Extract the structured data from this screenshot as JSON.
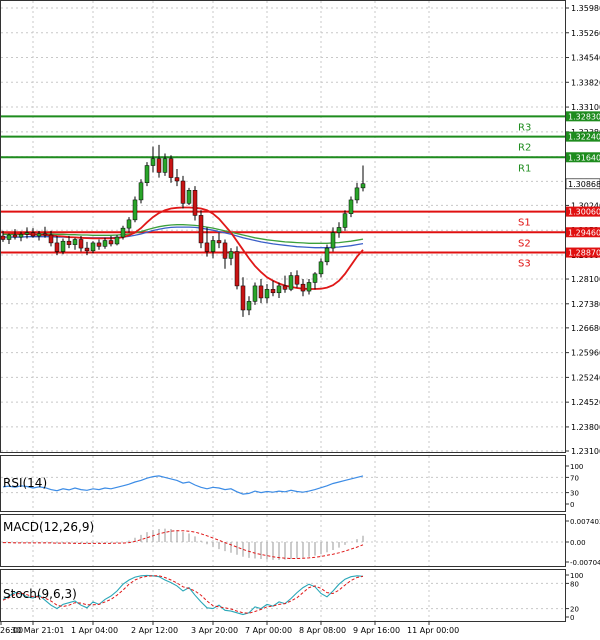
{
  "chart_data": {
    "type": "candlestick",
    "main": {
      "price_ticks": [
        "1.35980",
        "1.35260",
        "1.34540",
        "1.33820",
        "1.33100",
        "1.32380",
        "1.31660",
        "1.30940",
        "1.30240",
        "1.29520",
        "1.28800",
        "1.28100",
        "1.27380",
        "1.26680",
        "1.25960",
        "1.25240",
        "1.24520",
        "1.23800",
        "1.23100"
      ],
      "price_tick_values": [
        1.3598,
        1.3526,
        1.3454,
        1.3382,
        1.331,
        1.3238,
        1.3166,
        1.3094,
        1.3024,
        1.2952,
        1.288,
        1.281,
        1.2738,
        1.2668,
        1.2596,
        1.2524,
        1.2452,
        1.238,
        1.231
      ],
      "ylim": [
        1.231,
        1.3598
      ],
      "current_price": {
        "value": 1.30868,
        "label": "1.30868"
      },
      "levels": [
        {
          "name": "R3",
          "value": 1.3283,
          "label": "1.32830",
          "color": "#1e8c1e"
        },
        {
          "name": "R2",
          "value": 1.3224,
          "label": "1.32240",
          "color": "#1e8c1e"
        },
        {
          "name": "R1",
          "value": 1.3164,
          "label": "1.31640",
          "color": "#1e8c1e"
        },
        {
          "name": "S1",
          "value": 1.3006,
          "label": "1.30060",
          "color": "#e01010"
        },
        {
          "name": "S2",
          "value": 1.2946,
          "label": "1.29460",
          "color": "#e01010"
        },
        {
          "name": "S3",
          "value": 1.2887,
          "label": "1.28870",
          "color": "#e01010"
        }
      ],
      "candles": [
        [
          1.2935,
          1.295,
          1.2918,
          1.2925
        ],
        [
          1.2925,
          1.2942,
          1.2912,
          1.2938
        ],
        [
          1.2938,
          1.2955,
          1.2925,
          1.2932
        ],
        [
          1.2932,
          1.2948,
          1.292,
          1.294
        ],
        [
          1.294,
          1.296,
          1.2928,
          1.2945
        ],
        [
          1.2945,
          1.2958,
          1.293,
          1.2935
        ],
        [
          1.2935,
          1.295,
          1.2922,
          1.2942
        ],
        [
          1.2942,
          1.2962,
          1.293,
          1.2938
        ],
        [
          1.2938,
          1.295,
          1.2905,
          1.2915
        ],
        [
          1.2915,
          1.2935,
          1.288,
          1.289
        ],
        [
          1.289,
          1.2928,
          1.2882,
          1.292
        ],
        [
          1.292,
          1.2935,
          1.29,
          1.291
        ],
        [
          1.291,
          1.293,
          1.2895,
          1.2925
        ],
        [
          1.2925,
          1.2935,
          1.289,
          1.29
        ],
        [
          1.29,
          1.2918,
          1.288,
          1.2892
        ],
        [
          1.2892,
          1.292,
          1.2885,
          1.2915
        ],
        [
          1.2915,
          1.2925,
          1.2895,
          1.2905
        ],
        [
          1.2905,
          1.293,
          1.2898,
          1.2922
        ],
        [
          1.2922,
          1.2935,
          1.2905,
          1.2912
        ],
        [
          1.2912,
          1.2938,
          1.2908,
          1.2932
        ],
        [
          1.2932,
          1.2965,
          1.2925,
          1.2958
        ],
        [
          1.2958,
          1.299,
          1.2945,
          1.2982
        ],
        [
          1.2982,
          1.305,
          1.2975,
          1.304
        ],
        [
          1.304,
          1.31,
          1.303,
          1.309
        ],
        [
          1.309,
          1.315,
          1.308,
          1.314
        ],
        [
          1.314,
          1.3195,
          1.312,
          1.316
        ],
        [
          1.316,
          1.32,
          1.3105,
          1.312
        ],
        [
          1.312,
          1.3175,
          1.311,
          1.316
        ],
        [
          1.316,
          1.317,
          1.309,
          1.3105
        ],
        [
          1.3105,
          1.313,
          1.308,
          1.3095
        ],
        [
          1.3095,
          1.311,
          1.3015,
          1.303
        ],
        [
          1.303,
          1.3075,
          1.3025,
          1.3068
        ],
        [
          1.3068,
          1.308,
          1.298,
          1.2995
        ],
        [
          1.2995,
          1.301,
          1.29,
          1.2915
        ],
        [
          1.2915,
          1.296,
          1.2875,
          1.289
        ],
        [
          1.289,
          1.2935,
          1.287,
          1.2922
        ],
        [
          1.2922,
          1.2945,
          1.29,
          1.2915
        ],
        [
          1.2915,
          1.2925,
          1.284,
          1.287
        ],
        [
          1.287,
          1.29,
          1.285,
          1.289
        ],
        [
          1.289,
          1.2905,
          1.278,
          1.279
        ],
        [
          1.279,
          1.2815,
          1.27,
          1.272
        ],
        [
          1.272,
          1.276,
          1.2705,
          1.2745
        ],
        [
          1.2745,
          1.28,
          1.2735,
          1.279
        ],
        [
          1.279,
          1.281,
          1.274,
          1.2755
        ],
        [
          1.2755,
          1.2795,
          1.274,
          1.278
        ],
        [
          1.278,
          1.2805,
          1.276,
          1.277
        ],
        [
          1.277,
          1.28,
          1.2755,
          1.279
        ],
        [
          1.279,
          1.282,
          1.277,
          1.278
        ],
        [
          1.278,
          1.283,
          1.2775,
          1.282
        ],
        [
          1.282,
          1.2835,
          1.2785,
          1.2795
        ],
        [
          1.2795,
          1.281,
          1.276,
          1.2775
        ],
        [
          1.2775,
          1.281,
          1.2765,
          1.28
        ],
        [
          1.28,
          1.283,
          1.278,
          1.2825
        ],
        [
          1.2825,
          1.287,
          1.2815,
          1.286
        ],
        [
          1.286,
          1.291,
          1.285,
          1.29
        ],
        [
          1.29,
          1.296,
          1.289,
          1.2945
        ],
        [
          1.2945,
          1.2975,
          1.293,
          1.296
        ],
        [
          1.296,
          1.301,
          1.295,
          1.3
        ],
        [
          1.3,
          1.305,
          1.299,
          1.304
        ],
        [
          1.304,
          1.309,
          1.303,
          1.3075
        ],
        [
          1.3075,
          1.314,
          1.3065,
          1.3087
        ]
      ],
      "red_ma": [
        1.2945,
        1.2944,
        1.2943,
        1.2942,
        1.2941,
        1.294,
        1.2939,
        1.2938,
        1.2937,
        1.2935,
        1.2934,
        1.2932,
        1.2931,
        1.293,
        1.2929,
        1.2928,
        1.2928,
        1.2928,
        1.2928,
        1.2929,
        1.2932,
        1.2937,
        1.2945,
        1.2958,
        1.2975,
        1.299,
        1.3002,
        1.301,
        1.3015,
        1.3017,
        1.3018,
        1.3018,
        1.3017,
        1.3015,
        1.301,
        1.3,
        1.2985,
        1.2965,
        1.2945,
        1.292,
        1.2895,
        1.287,
        1.2848,
        1.283,
        1.2815,
        1.2805,
        1.2797,
        1.2791,
        1.2787,
        1.2784,
        1.2782,
        1.2781,
        1.2781,
        1.2782,
        1.2785,
        1.2792,
        1.2805,
        1.2825,
        1.285,
        1.2875,
        1.2895
      ],
      "green_ma": [
        1.294,
        1.294,
        1.294,
        1.294,
        1.2941,
        1.2941,
        1.2941,
        1.2941,
        1.2941,
        1.294,
        1.294,
        1.2939,
        1.2939,
        1.2938,
        1.2938,
        1.2937,
        1.2937,
        1.2937,
        1.2937,
        1.2938,
        1.2939,
        1.2941,
        1.2944,
        1.2948,
        1.2953,
        1.2958,
        1.2962,
        1.2965,
        1.2967,
        1.2968,
        1.2968,
        1.2967,
        1.2966,
        1.2964,
        1.2961,
        1.2958,
        1.2954,
        1.295,
        1.2946,
        1.2942,
        1.2938,
        1.2934,
        1.293,
        1.2927,
        1.2924,
        1.2922,
        1.292,
        1.2918,
        1.2917,
        1.2916,
        1.2915,
        1.2914,
        1.2914,
        1.2914,
        1.2914,
        1.2915,
        1.2916,
        1.2918,
        1.292,
        1.2923,
        1.2926
      ],
      "blue_ma": [
        1.2932,
        1.2932,
        1.2932,
        1.2932,
        1.2933,
        1.2933,
        1.2933,
        1.2933,
        1.2933,
        1.2932,
        1.2932,
        1.2931,
        1.2931,
        1.293,
        1.293,
        1.293,
        1.293,
        1.293,
        1.293,
        1.2931,
        1.2932,
        1.2934,
        1.2937,
        1.2941,
        1.2946,
        1.2951,
        1.2955,
        1.2958,
        1.296,
        1.2961,
        1.2961,
        1.2961,
        1.296,
        1.2958,
        1.2955,
        1.2952,
        1.2948,
        1.2944,
        1.294,
        1.2935,
        1.293,
        1.2926,
        1.2922,
        1.2918,
        1.2915,
        1.2912,
        1.291,
        1.2908,
        1.2906,
        1.2904,
        1.2903,
        1.2902,
        1.2901,
        1.2901,
        1.2901,
        1.2902,
        1.2903,
        1.2905,
        1.2907,
        1.291,
        1.2913
      ]
    },
    "rsi": {
      "label": "RSI(14)",
      "ticks": [
        "100",
        "70",
        "30",
        "0"
      ],
      "tick_values": [
        100,
        70,
        30,
        0
      ],
      "ylim": [
        0,
        100
      ],
      "values": [
        45,
        47,
        44,
        48,
        46,
        42,
        45,
        43,
        38,
        35,
        40,
        37,
        42,
        38,
        36,
        40,
        38,
        42,
        40,
        44,
        48,
        52,
        58,
        62,
        68,
        72,
        74,
        70,
        66,
        62,
        55,
        58,
        50,
        44,
        40,
        44,
        42,
        38,
        40,
        32,
        26,
        28,
        34,
        30,
        33,
        31,
        34,
        32,
        36,
        33,
        31,
        34,
        38,
        43,
        48,
        54,
        58,
        62,
        66,
        70,
        74
      ]
    },
    "macd": {
      "label": "MACD(12,26,9)",
      "ticks": [
        "0.007403",
        "0.00",
        "-0.007049"
      ],
      "tick_values": [
        0.007403,
        0,
        -0.007049
      ],
      "ylim": [
        -0.007049,
        0.007403
      ],
      "hist": [
        -0.0004,
        -0.0004,
        -0.0003,
        -0.0003,
        -0.0003,
        -0.0002,
        -0.0003,
        -0.0003,
        -0.0004,
        -0.0005,
        -0.0005,
        -0.0005,
        -0.0005,
        -0.0006,
        -0.0006,
        -0.0005,
        -0.0005,
        -0.0005,
        -0.0004,
        -0.0003,
        -0.0001,
        0.0005,
        0.0015,
        0.0025,
        0.0035,
        0.0042,
        0.0046,
        0.0047,
        0.0046,
        0.0042,
        0.0035,
        0.003,
        0.002,
        0.0005,
        -0.0008,
        -0.0018,
        -0.0025,
        -0.0032,
        -0.0038,
        -0.0045,
        -0.0052,
        -0.0056,
        -0.0058,
        -0.006,
        -0.0062,
        -0.0063,
        -0.0063,
        -0.0062,
        -0.006,
        -0.0058,
        -0.0055,
        -0.0052,
        -0.0048,
        -0.0043,
        -0.0036,
        -0.0028,
        -0.002,
        -0.001,
        0.0,
        0.001,
        0.0022
      ],
      "signal": [
        -0.0002,
        -0.0002,
        -0.0003,
        -0.0003,
        -0.0003,
        -0.0003,
        -0.0003,
        -0.0003,
        -0.0003,
        -0.0004,
        -0.0004,
        -0.0004,
        -0.0005,
        -0.0005,
        -0.0005,
        -0.0005,
        -0.0005,
        -0.0005,
        -0.0005,
        -0.0004,
        -0.0004,
        -0.0002,
        0.0002,
        0.0008,
        0.0015,
        0.0022,
        0.0029,
        0.0034,
        0.0038,
        0.004,
        0.004,
        0.0038,
        0.0035,
        0.0029,
        0.0022,
        0.0014,
        0.0006,
        -0.0002,
        -0.001,
        -0.0018,
        -0.0026,
        -0.0033,
        -0.0039,
        -0.0044,
        -0.0048,
        -0.0052,
        -0.0055,
        -0.0057,
        -0.0058,
        -0.0058,
        -0.0057,
        -0.0056,
        -0.0054,
        -0.0051,
        -0.0047,
        -0.0043,
        -0.0038,
        -0.0032,
        -0.0025,
        -0.0018,
        -0.001
      ]
    },
    "stoch": {
      "label": "Stoch(9,6,3)",
      "ticks": [
        "100",
        "80",
        "20",
        "0"
      ],
      "tick_values": [
        100,
        80,
        20,
        0
      ],
      "ylim": [
        0,
        100
      ],
      "k": [
        42,
        50,
        58,
        55,
        48,
        45,
        52,
        40,
        28,
        20,
        30,
        34,
        38,
        28,
        22,
        36,
        30,
        42,
        50,
        62,
        78,
        88,
        95,
        98,
        99,
        98,
        96,
        88,
        82,
        74,
        62,
        70,
        52,
        36,
        22,
        20,
        28,
        16,
        14,
        10,
        6,
        10,
        24,
        20,
        30,
        26,
        36,
        32,
        44,
        58,
        70,
        78,
        72,
        56,
        48,
        62,
        78,
        90,
        96,
        98,
        97
      ],
      "d": [
        40,
        46,
        54,
        57,
        53,
        48,
        48,
        45,
        38,
        28,
        25,
        28,
        34,
        33,
        29,
        29,
        30,
        36,
        42,
        52,
        64,
        78,
        88,
        94,
        97,
        98,
        98,
        94,
        88,
        81,
        72,
        68,
        62,
        52,
        38,
        27,
        24,
        22,
        19,
        14,
        10,
        9,
        13,
        18,
        24,
        26,
        30,
        32,
        38,
        46,
        58,
        70,
        74,
        68,
        58,
        56,
        64,
        76,
        87,
        94,
        97
      ]
    },
    "time_ticks": [
      "26:00",
      "30 Mar 21:01",
      "1 Apr 04:00",
      "2 Apr 12:00",
      "3 Apr 20:00",
      "7 Apr 00:00",
      "8 Apr 08:00",
      "9 Apr 16:00",
      "11 Apr 00:00"
    ],
    "time_tick_index": [
      -2,
      5,
      15,
      25,
      35,
      44,
      53,
      62,
      71
    ]
  }
}
